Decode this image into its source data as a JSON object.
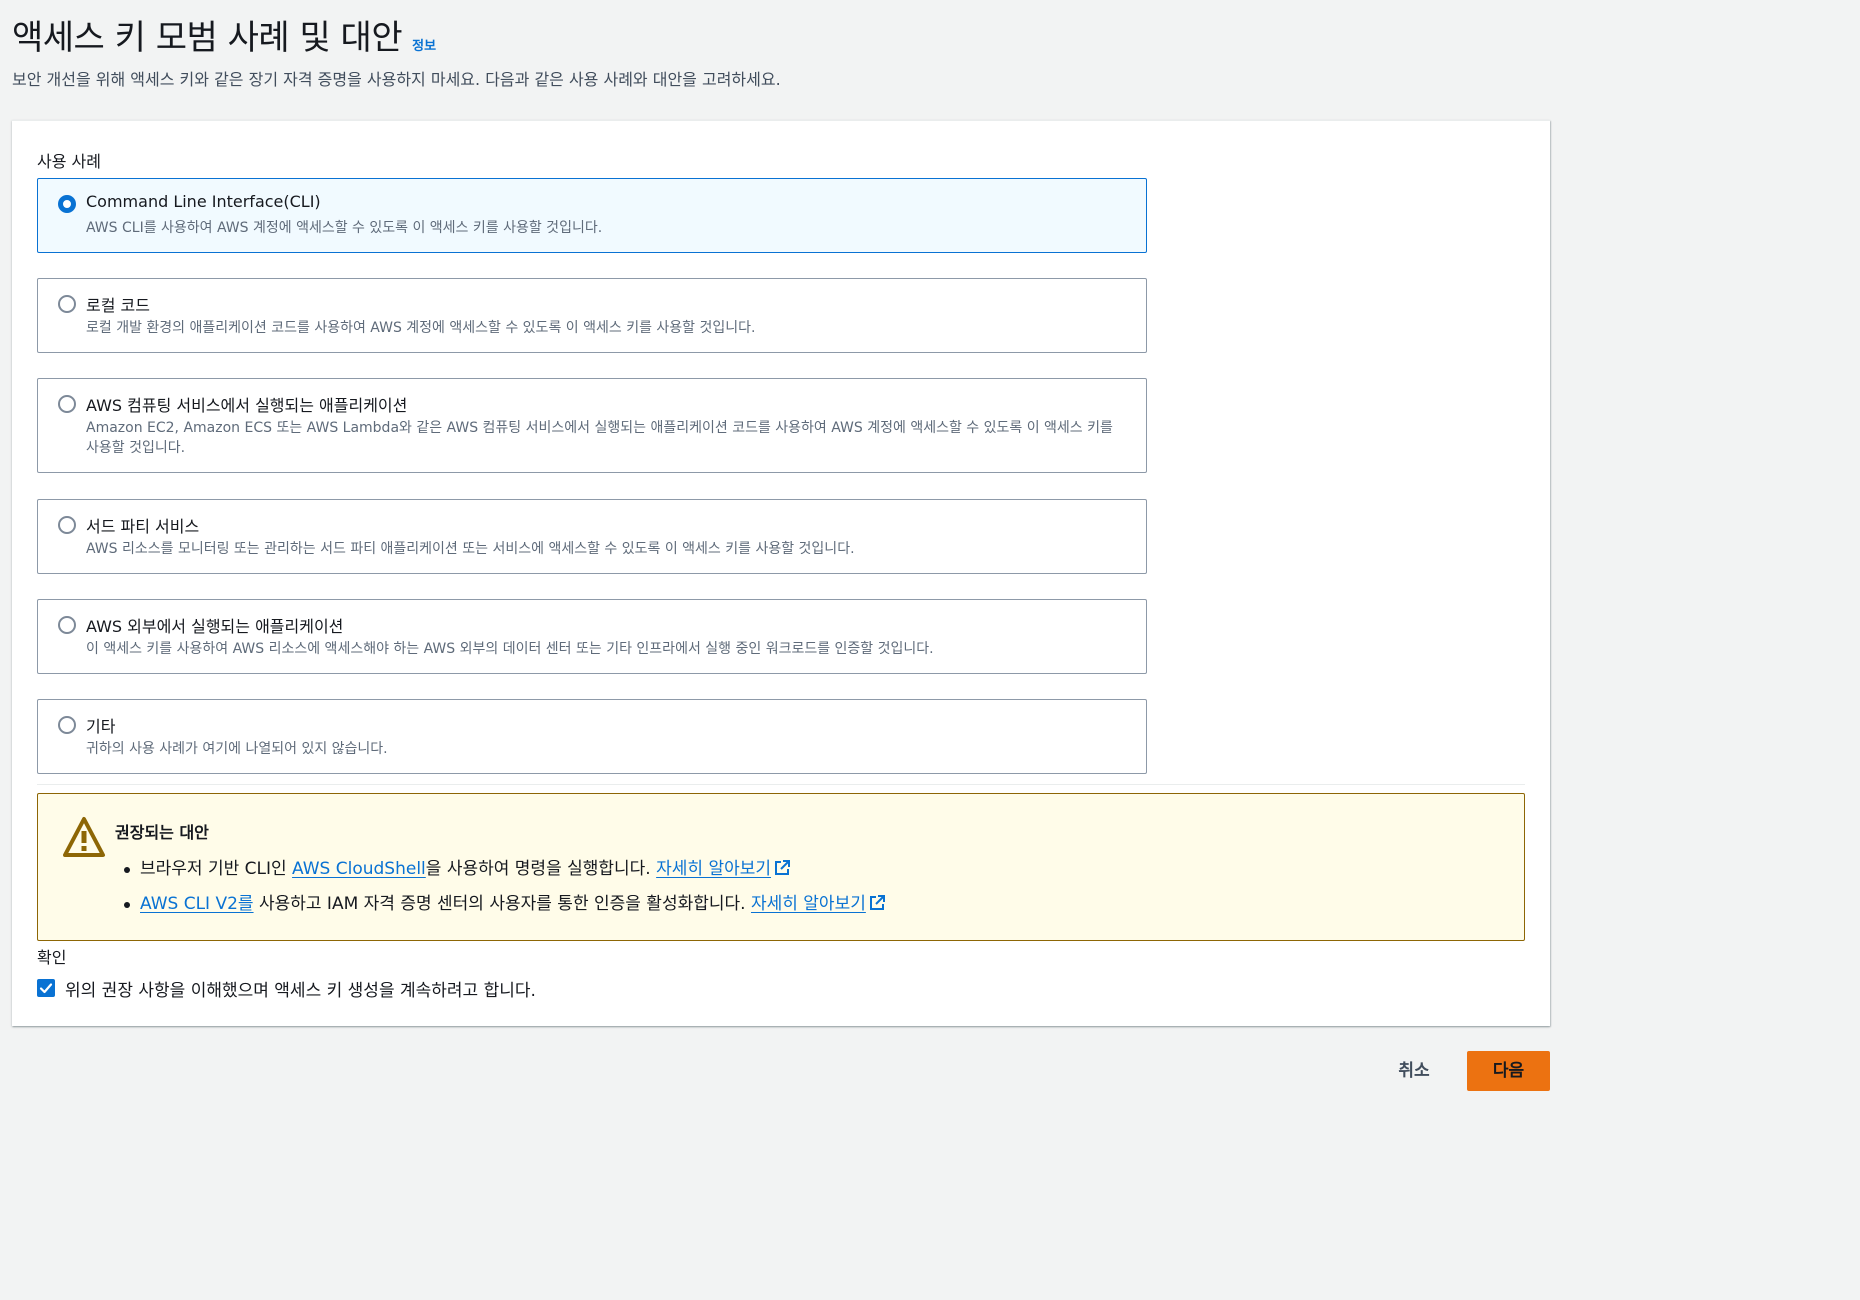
{
  "header": {
    "title": "액세스 키 모범 사례 및 대안",
    "info_link": "정보",
    "subtitle": "보안 개선을 위해 액세스 키와 같은 장기 자격 증명을 사용하지 마세요. 다음과 같은 사용 사례와 대안을 고려하세요."
  },
  "use_case": {
    "label": "사용 사례",
    "selected_index": 0,
    "options": [
      {
        "title": "Command Line Interface(CLI)",
        "desc": "AWS CLI를 사용하여 AWS 계정에 액세스할 수 있도록 이 액세스 키를 사용할 것입니다."
      },
      {
        "title": "로컬 코드",
        "desc": "로컬 개발 환경의 애플리케이션 코드를 사용하여 AWS 계정에 액세스할 수 있도록 이 액세스 키를 사용할 것입니다."
      },
      {
        "title": "AWS 컴퓨팅 서비스에서 실행되는 애플리케이션",
        "desc": "Amazon EC2, Amazon ECS 또는 AWS Lambda와 같은 AWS 컴퓨팅 서비스에서 실행되는 애플리케이션 코드를 사용하여 AWS 계정에 액세스할 수 있도록 이 액세스 키를 사용할 것입니다."
      },
      {
        "title": "서드 파티 서비스",
        "desc": "AWS 리소스를 모니터링 또는 관리하는 서드 파티 애플리케이션 또는 서비스에 액세스할 수 있도록 이 액세스 키를 사용할 것입니다."
      },
      {
        "title": "AWS 외부에서 실행되는 애플리케이션",
        "desc": "이 액세스 키를 사용하여 AWS 리소스에 액세스해야 하는 AWS 외부의 데이터 센터 또는 기타 인프라에서 실행 중인 워크로드를 인증할 것입니다."
      },
      {
        "title": "기타",
        "desc": "귀하의 사용 사례가 여기에 나열되어 있지 않습니다."
      }
    ]
  },
  "alert": {
    "title": "권장되는 대안",
    "item1": {
      "prefix": "브라우저 기반 CLI인 ",
      "link": "AWS CloudShell",
      "suffix": "을 사용하여 명령을 실행합니다. ",
      "learn_more": "자세히 알아보기"
    },
    "item2": {
      "link": "AWS CLI V2를",
      "suffix": " 사용하고 IAM 자격 증명 센터의 사용자를 통한 인증을 활성화합니다. ",
      "learn_more": "자세히 알아보기"
    }
  },
  "confirm": {
    "label": "확인",
    "checked": true,
    "text": "위의 권장 사항을 이해했으며 액세스 키 생성을 계속하려고 합니다."
  },
  "footer": {
    "cancel_label": "취소",
    "next_label": "다음"
  },
  "colors": {
    "link": "#0972d3",
    "primary_button": "#ec7211",
    "warning_bg": "#fffce9",
    "warning_border": "#8d6605"
  }
}
